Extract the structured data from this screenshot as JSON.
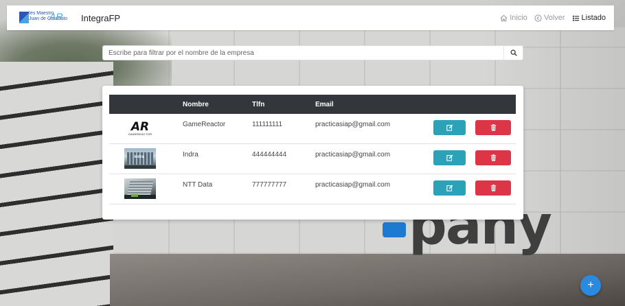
{
  "brand": {
    "logo_text_line1": "Ies Maestro",
    "logo_text_line2": "Juan de Garabato",
    "logo_ar": "AR",
    "name": "IntegraFP"
  },
  "nav": {
    "inicio": "Inicio",
    "volver": "Volver",
    "listado": "Listado"
  },
  "search": {
    "placeholder": "Escribe para filtrar por el nombre de la empresa"
  },
  "table": {
    "headers": {
      "nombre": "Nombre",
      "tlfn": "Tlfn",
      "email": "Email"
    },
    "rows": [
      {
        "nombre": "GameReactor",
        "tlfn": "111111111",
        "email": "practicasiap@gmail.com",
        "logo": "gamereactor-logo"
      },
      {
        "nombre": "Indra",
        "tlfn": "444444444",
        "email": "practicasiap@gmail.com",
        "logo": "indra-building-photo"
      },
      {
        "nombre": "NTT Data",
        "tlfn": "777777777",
        "email": "practicasiap@gmail.com",
        "logo": "ntt-data-building-photo"
      }
    ]
  },
  "thumb_text": {
    "ar_big": "AR",
    "ar_small": "GAMEREACTOR",
    "indra": "indra"
  },
  "background_word": "pany",
  "fab_label": "+",
  "colors": {
    "header_bg": "#33373b",
    "edit_button": "#2aa3b8",
    "delete_button": "#dc3545",
    "fab": "#2a8ae0",
    "brand_blue": "#2b56b3"
  }
}
